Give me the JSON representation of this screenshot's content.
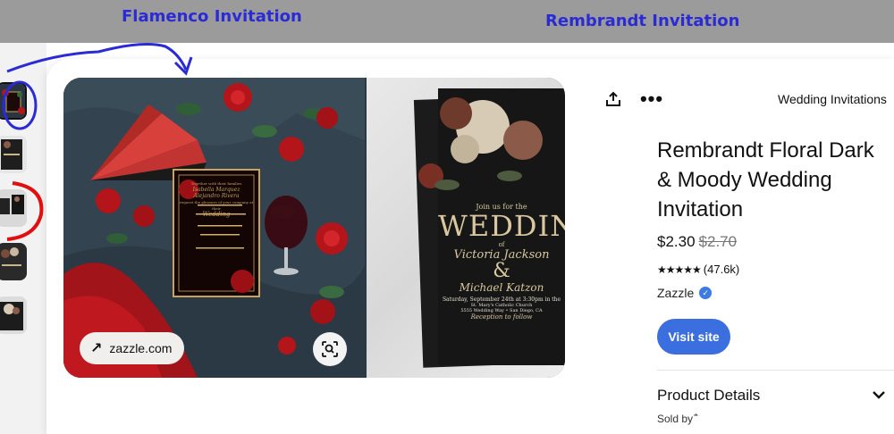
{
  "annotations": {
    "left_label": "Flamenco Invitation",
    "right_label": "Rembrandt Invitation"
  },
  "gallery": {
    "thumbnails": [
      "thumb-1",
      "thumb-2",
      "thumb-3",
      "thumb-4",
      "thumb-5"
    ],
    "selected_index": 0
  },
  "image": {
    "source_label": "zazzle.com",
    "source_icon": "arrow-up-right-icon",
    "lens_icon": "visual-search-icon",
    "left_card": {
      "line1": "Together with their families",
      "line2": "Isabella Marquez",
      "line3": "Alejandro Rivera",
      "line4": "request the pleasure of your company at their",
      "line5": "Wedding"
    },
    "right_card": {
      "intro": "Join us for the",
      "headline": "WEDDING",
      "of": "of",
      "name1": "Victoria Jackson",
      "amp": "&",
      "name2": "Michael Katzon",
      "date": "Saturday, September 24th at 3:30pm in the",
      "venue": "St. Mary's Catholic Church",
      "address": "5555 Wedding Way • San Diego, CA",
      "reception": "Reception to follow"
    }
  },
  "actions": {
    "share_icon": "share-icon",
    "more_icon": "more-icon",
    "more_glyph": "•••"
  },
  "product": {
    "category": "Wedding Invitations",
    "title": "Rembrandt Floral Dark & Moody Wedding Invitation",
    "price": "$2.30",
    "old_price": "$2.70",
    "stars": "★★★★★",
    "rating_value": 5,
    "rating_count": "(47.6k)",
    "seller": "Zazzle",
    "verified_glyph": "✓",
    "visit_label": "Visit site",
    "details_heading": "Product Details",
    "sold_by": "Sold by 𞀀"
  },
  "colors": {
    "annotation_blue": "#2b2bd6",
    "annotation_red": "#e01010",
    "visit_button": "#3b6fe0",
    "verified_badge": "#3d7be0",
    "top_band": "#9b9b9b"
  }
}
